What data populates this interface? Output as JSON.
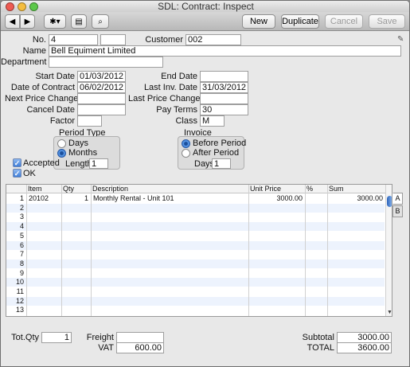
{
  "window": {
    "title": "SDL: Contract: Inspect"
  },
  "toolbar": {
    "new_label": "New",
    "duplicate_label": "Duplicate",
    "cancel_label": "Cancel",
    "save_label": "Save"
  },
  "header": {
    "no_label": "No.",
    "no_value": "4",
    "customer_label": "Customer",
    "customer_value": "002",
    "name_label": "Name",
    "name_value": "Bell Equiment Limited",
    "department_label": "Department",
    "department_value": ""
  },
  "dates": {
    "start_date_label": "Start Date",
    "start_date": "01/03/2012",
    "end_date_label": "End Date",
    "end_date": "",
    "date_of_contract_label": "Date of Contract",
    "date_of_contract": "06/02/2012",
    "last_inv_date_label": "Last Inv. Date",
    "last_inv_date": "31/03/2012",
    "next_price_change_label": "Next Price Change",
    "next_price_change": "",
    "last_price_change_label": "Last Price Change",
    "last_price_change": "",
    "cancel_date_label": "Cancel Date",
    "cancel_date": "",
    "pay_terms_label": "Pay Terms",
    "pay_terms": "30",
    "factor_label": "Factor",
    "factor": "",
    "class_label": "Class",
    "class_value": "M"
  },
  "period_type": {
    "title": "Period Type",
    "days_label": "Days",
    "months_label": "Months",
    "selected": "Months",
    "length_label": "Length",
    "length_value": "1"
  },
  "invoice": {
    "title": "Invoice",
    "before_label": "Before Period",
    "after_label": "After Period",
    "selected": "Before Period",
    "days_label": "Days",
    "days_value": "1"
  },
  "flags": {
    "accepted_label": "Accepted",
    "accepted_checked": true,
    "ok_label": "OK",
    "ok_checked": true
  },
  "grid": {
    "columns": [
      "Item",
      "Qty",
      "Description",
      "Unit Price",
      "%",
      "Sum"
    ],
    "rows": [
      {
        "n": "1",
        "item": "20102",
        "qty": "1",
        "description": "Monthly Rental - Unit 101",
        "unit_price": "3000.00",
        "pct": "",
        "sum": "3000.00"
      },
      {
        "n": "2"
      },
      {
        "n": "3"
      },
      {
        "n": "4"
      },
      {
        "n": "5"
      },
      {
        "n": "6"
      },
      {
        "n": "7"
      },
      {
        "n": "8"
      },
      {
        "n": "9"
      },
      {
        "n": "10"
      },
      {
        "n": "11"
      },
      {
        "n": "12"
      },
      {
        "n": "13"
      }
    ],
    "tabs": [
      "A",
      "B"
    ],
    "active_tab": "A"
  },
  "footer": {
    "tot_qty_label": "Tot.Qty",
    "tot_qty": "1",
    "freight_label": "Freight",
    "freight": "",
    "vat_label": "VAT",
    "vat": "600.00",
    "subtotal_label": "Subtotal",
    "subtotal": "3000.00",
    "total_label": "TOTAL",
    "total": "3600.00"
  },
  "colors": {
    "close": "#ee5a52",
    "minimize": "#f4bd3e",
    "zoom": "#5cc84a",
    "row_alt": "#edf3fd",
    "radio_on": "#2f72d0"
  }
}
